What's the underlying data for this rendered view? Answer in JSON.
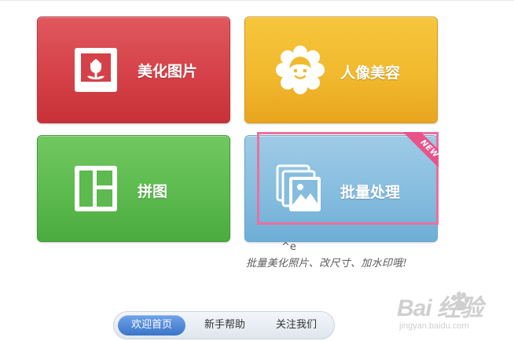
{
  "tiles": {
    "beautify": {
      "label": "美化图片",
      "icon": "flower-photo-icon",
      "color": "#d54148"
    },
    "portrait": {
      "label": "人像美容",
      "icon": "smiling-face-icon",
      "color": "#f1b92e"
    },
    "collage": {
      "label": "拼图",
      "icon": "collage-layout-icon",
      "color": "#5cba4e"
    },
    "batch": {
      "label": "批量处理",
      "icon": "photo-stack-icon",
      "color": "#86bddf",
      "badge": "NEW"
    }
  },
  "annotation": {
    "highlight_color": "#ee6f9a",
    "caret": "^e",
    "note": "批量美化照片、改尺寸、加水印哦!"
  },
  "watermark": {
    "main": "Bai 经验",
    "sub": "jingyan.baidu.com",
    "icon": "paw-icon"
  },
  "nav": {
    "items": [
      "欢迎首页",
      "新手帮助",
      "关注我们"
    ],
    "active": "欢迎首页"
  }
}
